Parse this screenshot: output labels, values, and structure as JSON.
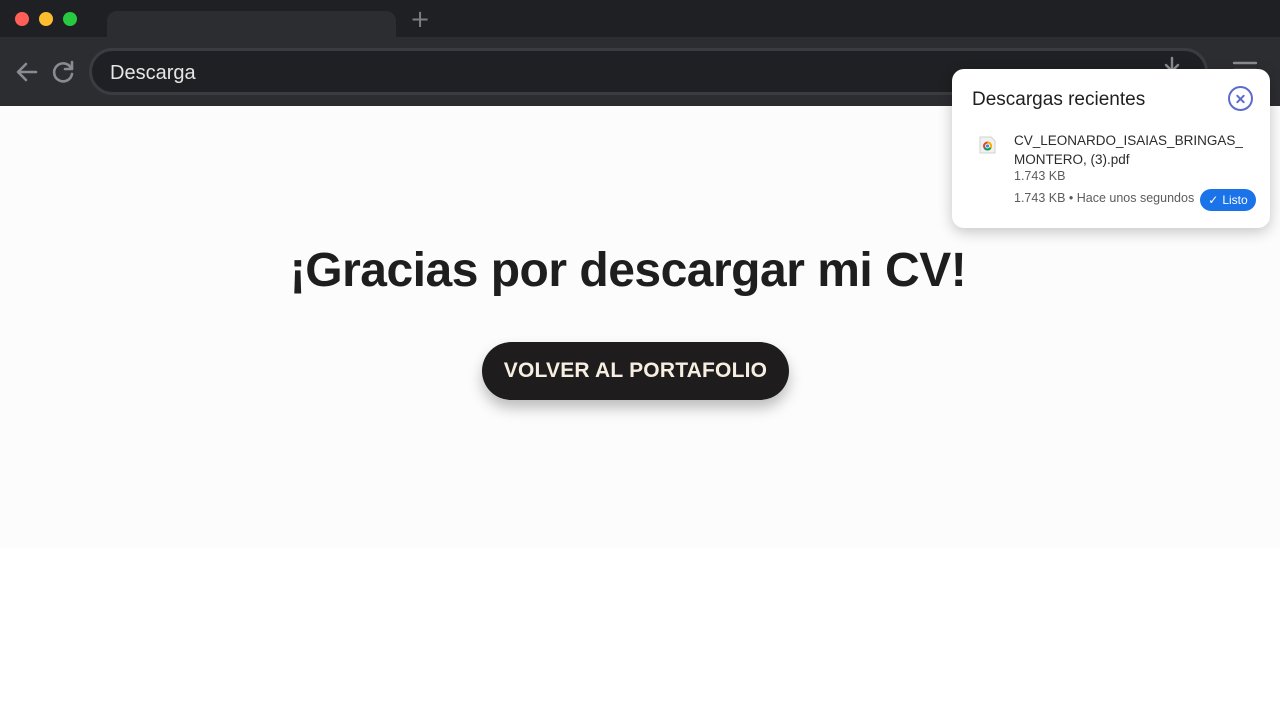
{
  "browser": {
    "address_bar": "Descarga"
  },
  "page": {
    "heading": "¡Gracias por descargar mi CV!",
    "cta_label": "VOLVER AL PORTAFOLIO"
  },
  "downloads_popup": {
    "title": "Descargas recientes",
    "items": [
      {
        "file_name": "CV_LEONARDO_ISAIAS_BRINGAS_MONTERO, (3).pdf",
        "size": "1.743 KB",
        "meta": "1.743 KB • Hace unos segundos",
        "status": "Listo",
        "icon": "chrome-file-icon"
      }
    ]
  },
  "colors": {
    "tab_strip": "#1f2023",
    "toolbar": "#2c2d31",
    "cta_background": "#1e1c1c",
    "cta_text": "#f7eee2",
    "status_blue": "#1a73e8",
    "close_icon": "#5d6bd1"
  }
}
